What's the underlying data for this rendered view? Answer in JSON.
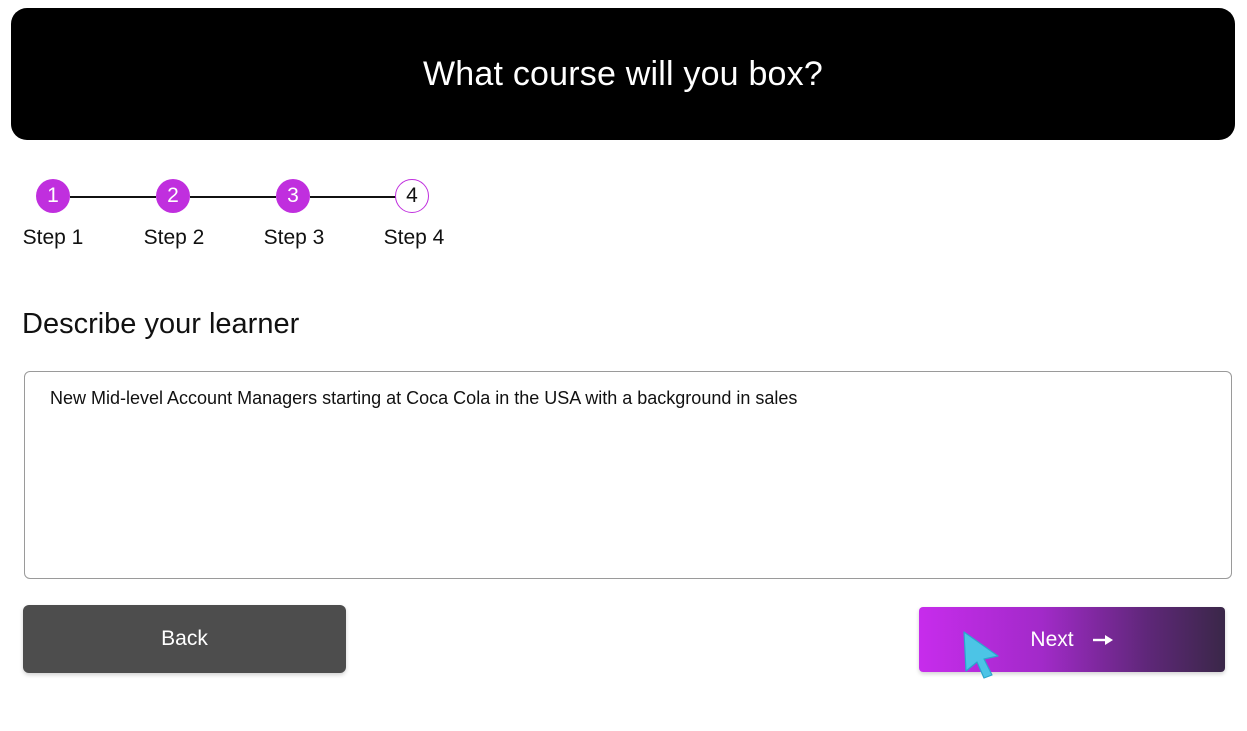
{
  "header": {
    "title": "What course will you box?"
  },
  "stepper": {
    "steps": [
      {
        "number": "1",
        "label": "Step 1",
        "state": "complete"
      },
      {
        "number": "2",
        "label": "Step 2",
        "state": "complete"
      },
      {
        "number": "3",
        "label": "Step 3",
        "state": "complete"
      },
      {
        "number": "4",
        "label": "Step 4",
        "state": "current"
      }
    ]
  },
  "form": {
    "section_title": "Describe your learner",
    "learner_description": "New Mid-level Account Managers starting at Coca Cola in the USA with a background in sales"
  },
  "actions": {
    "back_label": "Back",
    "next_label": "Next"
  },
  "icons": {
    "next_arrow": "arrow-right-icon",
    "cursor": "mouse-pointer-icon"
  },
  "colors": {
    "accent": "#c02fde",
    "header_bg": "#000000",
    "back_button": "#4d4d4d",
    "cursor": "#4cc4e6"
  }
}
